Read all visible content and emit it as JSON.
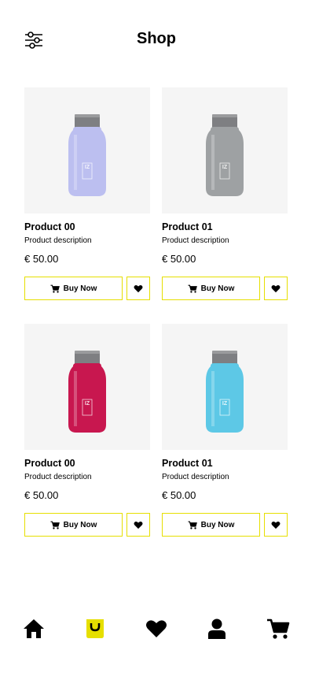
{
  "header": {
    "title": "Shop",
    "filter_icon": "sliders-icon"
  },
  "products": [
    {
      "name": "Product 00",
      "description": "Product description",
      "price": "€ 50.00",
      "buy_label": "Buy Now",
      "bottle_color": "#bcbff0",
      "logo": "IZ"
    },
    {
      "name": "Product 01",
      "description": "Product description",
      "price": "€ 50.00",
      "buy_label": "Buy Now",
      "bottle_color": "#9ea1a3",
      "logo": "IZ"
    },
    {
      "name": "Product 00",
      "description": "Product description",
      "price": "€ 50.00",
      "buy_label": "Buy Now",
      "bottle_color": "#c8174f",
      "logo": "IZ"
    },
    {
      "name": "Product 01",
      "description": "Product description",
      "price": "€ 50.00",
      "buy_label": "Buy Now",
      "bottle_color": "#5dc8e6",
      "logo": "IZ"
    }
  ],
  "bottom_nav": {
    "items": [
      "home-icon",
      "shop-bag-icon",
      "heart-icon",
      "user-icon",
      "cart-icon"
    ],
    "active": "shop-bag-icon",
    "accent": "#e6df00"
  }
}
